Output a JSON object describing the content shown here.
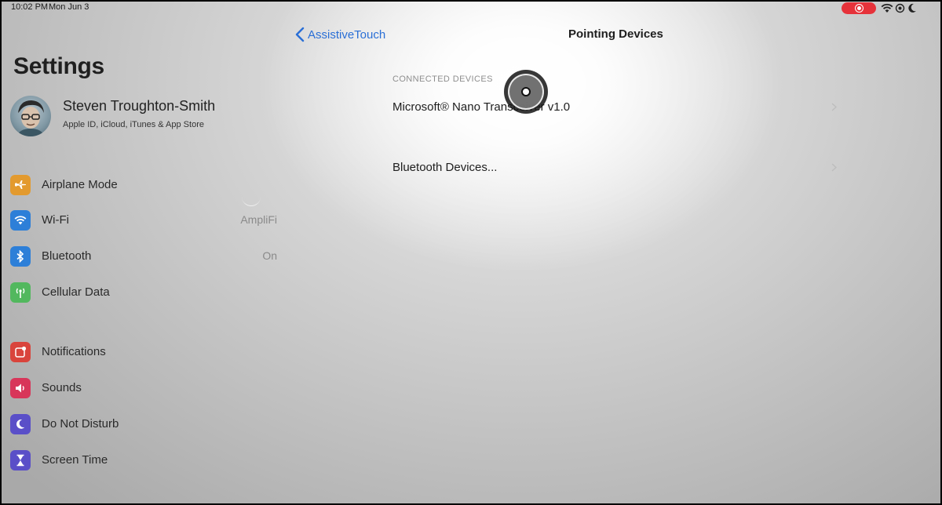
{
  "status_bar": {
    "time": "10:02 PM",
    "date": "Mon Jun 3",
    "icons": [
      "screen-recording-icon",
      "wifi-icon",
      "location-icon",
      "moon-icon"
    ],
    "record_color": "#e6323a"
  },
  "sidebar": {
    "title": "Settings",
    "profile": {
      "name": "Steven Troughton-Smith",
      "subtitle": "Apple ID, iCloud, iTunes & App Store"
    },
    "items": [
      {
        "label": "Airplane Mode",
        "value": "",
        "icon": "airplane-icon",
        "color": "#e39a2e"
      },
      {
        "label": "Wi-Fi",
        "value": "AmpliFi",
        "icon": "wifi-icon",
        "color": "#2d7fd8"
      },
      {
        "label": "Bluetooth",
        "value": "On",
        "icon": "bluetooth-icon",
        "color": "#2d7fd8"
      },
      {
        "label": "Cellular Data",
        "value": "",
        "icon": "antenna-icon",
        "color": "#52b85e"
      },
      {
        "label": "Notifications",
        "value": "",
        "icon": "notifications-icon",
        "color": "#d9443c"
      },
      {
        "label": "Sounds",
        "value": "",
        "icon": "speaker-icon",
        "color": "#d8365a"
      },
      {
        "label": "Do Not Disturb",
        "value": "",
        "icon": "moon-icon",
        "color": "#5a4fc8"
      },
      {
        "label": "Screen Time",
        "value": "",
        "icon": "hourglass-icon",
        "color": "#5a4fc8"
      }
    ]
  },
  "detail": {
    "back_label": "AssistiveTouch",
    "title": "Pointing Devices",
    "section_header": "CONNECTED DEVICES",
    "rows": [
      {
        "label": "Microsoft® Nano Transceiver v1.0"
      },
      {
        "label": "Bluetooth Devices..."
      }
    ],
    "accent_color": "#2a6fd6"
  }
}
